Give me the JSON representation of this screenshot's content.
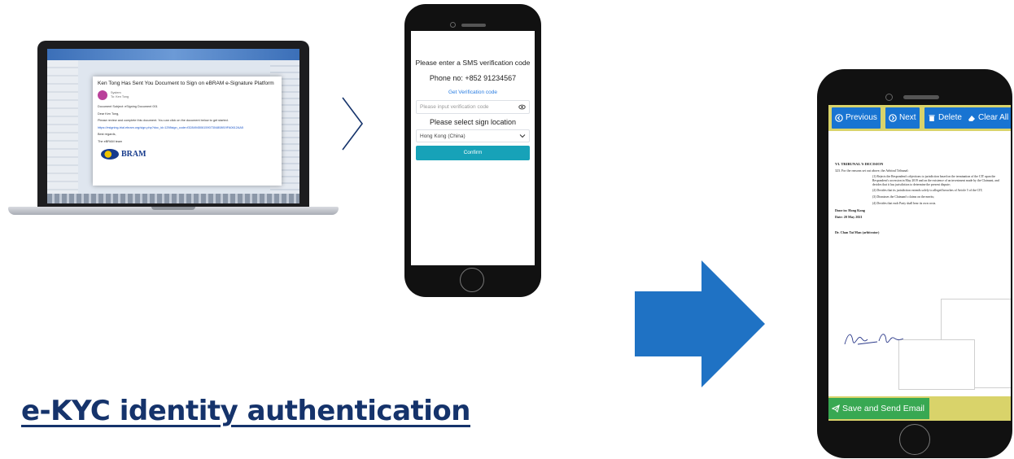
{
  "laptop_email": {
    "subject": "Ken Tong Has Sent You Document to Sign on eBRAM e-Signature Platform",
    "sender": "System",
    "recipient": "To: Ken Tong",
    "doc_subject": "Document Subject: eSigning Document 001",
    "greeting": "Dear Ken Tong,",
    "body": "Please review and complete this document. You can click on the document below to get started.",
    "link": "https://esigning-trial.ebram.org/sign.php?doc_id=1298sign_code=f32849450615907304808f19FA0612AA5",
    "regards": "Best regards,",
    "team": "The eBRAM team",
    "logo_text": "BRAM"
  },
  "sms_screen": {
    "title": "Please enter a SMS verification code",
    "phone_no": "Phone no: +852 91234567",
    "get_code_link": "Get Verification code",
    "code_placeholder": "Please input verification code",
    "location_title": "Please select sign location",
    "location_value": "Hong Kong (China)",
    "confirm_label": "Confirm"
  },
  "sign_screen": {
    "toolbar": {
      "previous_label": "Previous",
      "next_label": "Next",
      "delete_label": "Delete",
      "clear_all_label": "Clear All"
    },
    "document": {
      "section_heading": "VI.   TRIBUNAL'S DECISION",
      "intro": "323.   For the reasons set out above, the Arbitral Tribunal:",
      "items": [
        "(1)   Rejects the Respondent's objections to jurisdiction based on the termination of the CIT upon the Respondent's accession in May 2019 and on the existence of an investment made by the Claimant, and decides that it has jurisdiction to determine the present dispute;",
        "(2)   Decides that its jurisdiction extends solely to alleged breaches of Article 5 of the CIT;",
        "(3)   Dismisses the Claimant's claims on the merits;",
        "(4)   Decides that each Party shall bear its own costs."
      ],
      "place": "Done in: Hong Kong",
      "date": "Date: 20 May 2021",
      "arbitrator": "Dr. Chan Tai Man (arbitrator)"
    },
    "save_label": "Save and Send Email"
  },
  "heading": "e-KYC identity authentication",
  "colors": {
    "heading": "#15336b",
    "arrow": "#1f72c4",
    "toolbar_button": "#1874d2",
    "toolbar_bar": "#d9d36a",
    "save_button": "#38a852",
    "confirm_button": "#17a2b8"
  }
}
